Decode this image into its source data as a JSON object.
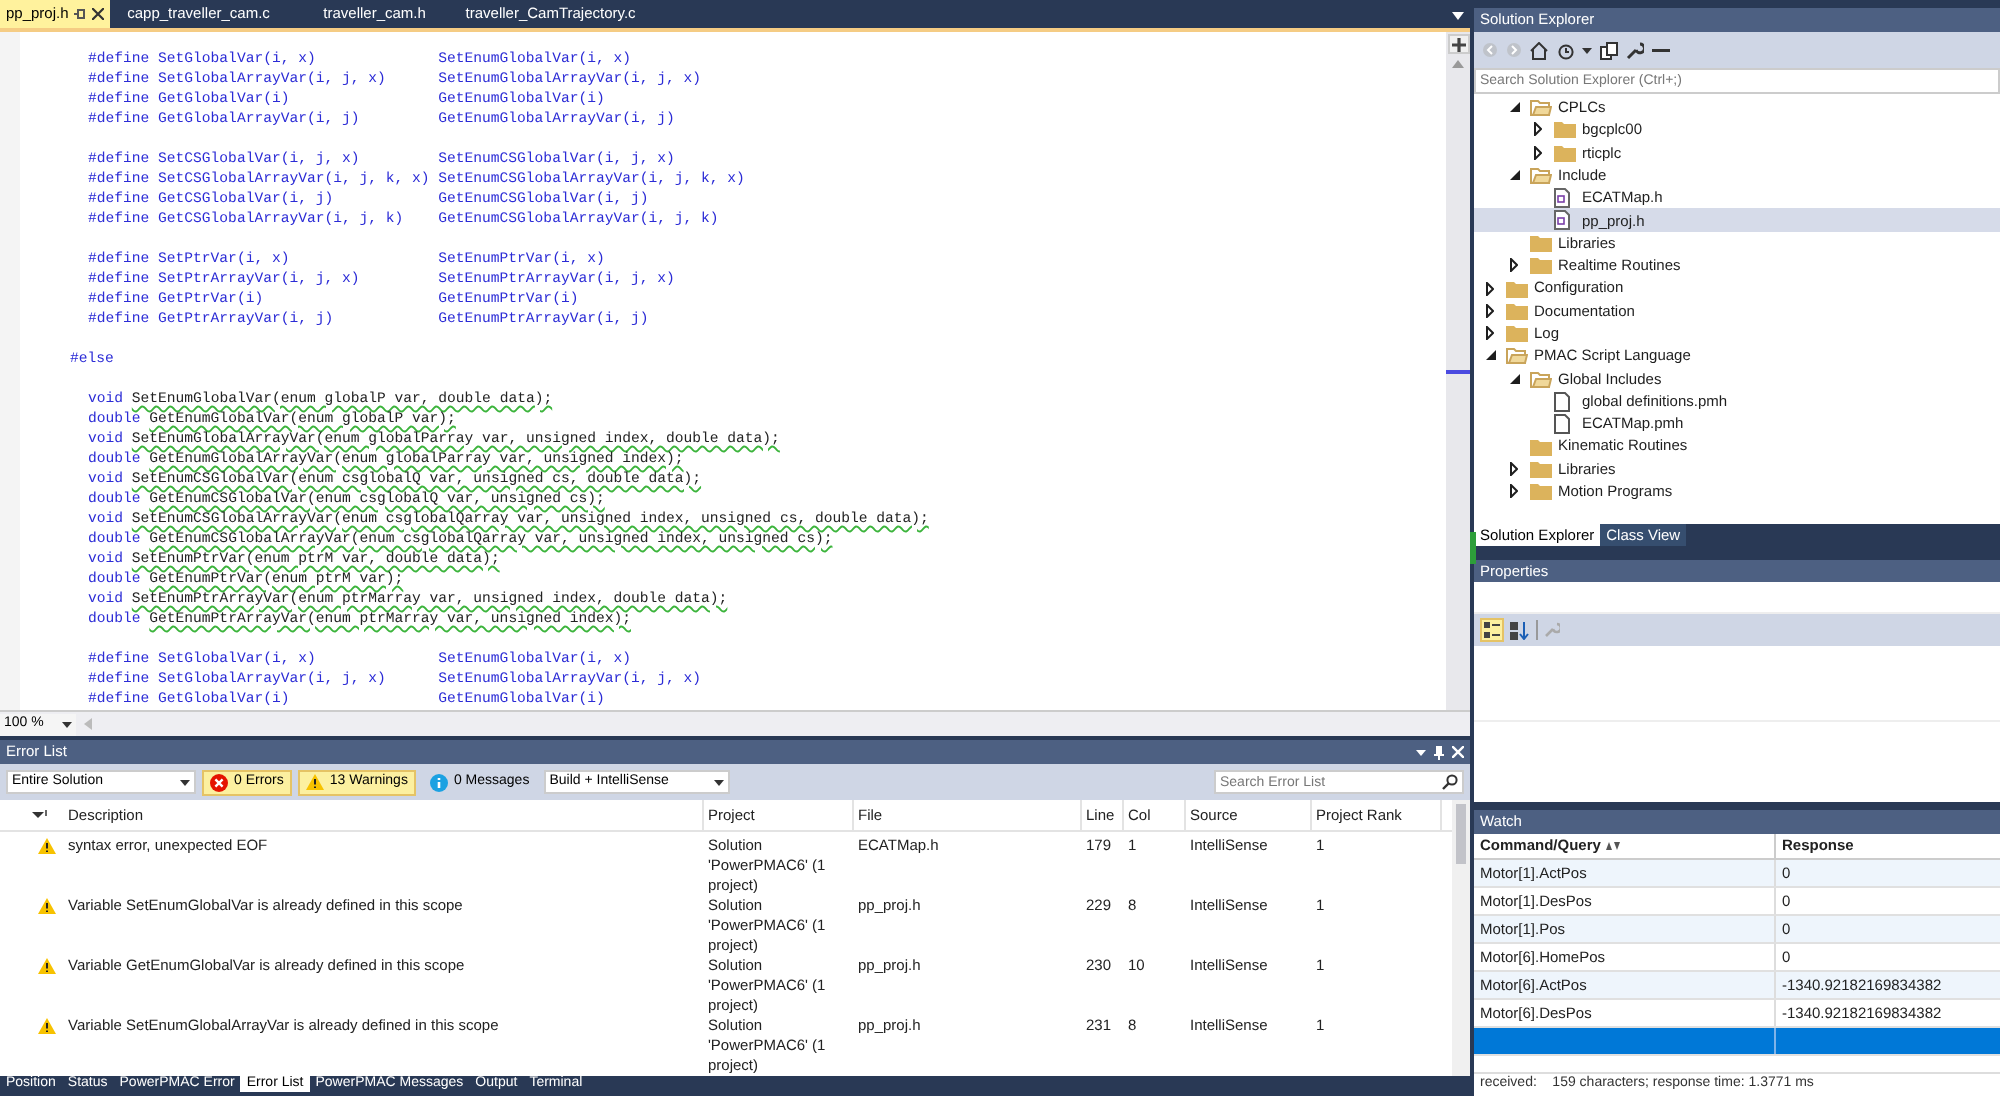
{
  "editor": {
    "tabs": [
      {
        "label": "pp_proj.h",
        "selected": true,
        "pinned": true
      },
      {
        "label": "capp_traveller_cam.c",
        "selected": false
      },
      {
        "label": "traveller_cam.h",
        "selected": false
      },
      {
        "label": "traveller_CamTrajectory.c",
        "selected": false
      }
    ],
    "lines": [
      {
        "kind": "define",
        "left": "#define SetGlobalVar(i, x)",
        "right": "SetEnumGlobalVar(i, x)"
      },
      {
        "kind": "define",
        "left": "#define SetGlobalArrayVar(i, j, x)",
        "right": "SetEnumGlobalArrayVar(i, j, x)"
      },
      {
        "kind": "define",
        "left": "#define GetGlobalVar(i)",
        "right": "GetEnumGlobalVar(i)"
      },
      {
        "kind": "define",
        "left": "#define GetGlobalArrayVar(i, j)",
        "right": "GetEnumGlobalArrayVar(i, j)"
      },
      {
        "kind": "blank"
      },
      {
        "kind": "define",
        "left": "#define SetCSGlobalVar(i, j, x)",
        "right": "SetEnumCSGlobalVar(i, j, x)"
      },
      {
        "kind": "define",
        "left": "#define SetCSGlobalArrayVar(i, j, k, x)",
        "right": "SetEnumCSGlobalArrayVar(i, j, k, x)"
      },
      {
        "kind": "define",
        "left": "#define GetCSGlobalVar(i, j)",
        "right": "GetEnumCSGlobalVar(i, j)"
      },
      {
        "kind": "define",
        "left": "#define GetCSGlobalArrayVar(i, j, k)",
        "right": "GetEnumCSGlobalArrayVar(i, j, k)"
      },
      {
        "kind": "blank"
      },
      {
        "kind": "define",
        "left": "#define SetPtrVar(i, x)",
        "right": "SetEnumPtrVar(i, x)"
      },
      {
        "kind": "define",
        "left": "#define SetPtrArrayVar(i, j, x)",
        "right": "SetEnumPtrArrayVar(i, j, x)"
      },
      {
        "kind": "define",
        "left": "#define GetPtrVar(i)",
        "right": "GetEnumPtrVar(i)"
      },
      {
        "kind": "define",
        "left": "#define GetPtrArrayVar(i, j)",
        "right": "GetEnumPtrArrayVar(i, j)"
      },
      {
        "kind": "blank"
      },
      {
        "kind": "directive",
        "text": "#else"
      },
      {
        "kind": "blank"
      },
      {
        "kind": "decl",
        "type": "void",
        "call": "SetEnumGlobalVar(enum globalP var, double data);",
        "squiggle": true
      },
      {
        "kind": "decl",
        "type": "double",
        "call": "GetEnumGlobalVar(enum globalP var);",
        "squiggle": true
      },
      {
        "kind": "decl",
        "type": "void",
        "call": "SetEnumGlobalArrayVar(enum globalParray var, unsigned index, double data);",
        "squiggle": true
      },
      {
        "kind": "decl",
        "type": "double",
        "call": "GetEnumGlobalArrayVar(enum globalParray var, unsigned index);",
        "squiggle": true
      },
      {
        "kind": "decl",
        "type": "void",
        "call": "SetEnumCSGlobalVar(enum csglobalQ var, unsigned cs, double data);",
        "squiggle": true
      },
      {
        "kind": "decl",
        "type": "double",
        "call": "GetEnumCSGlobalVar(enum csglobalQ var, unsigned cs);",
        "squiggle": true
      },
      {
        "kind": "decl",
        "type": "void",
        "call": "SetEnumCSGlobalArrayVar(enum csglobalQarray var, unsigned index, unsigned cs, double data);",
        "squiggle": true
      },
      {
        "kind": "decl",
        "type": "double",
        "call": "GetEnumCSGlobalArrayVar(enum csglobalQarray var, unsigned index, unsigned cs);",
        "squiggle": true
      },
      {
        "kind": "decl",
        "type": "void",
        "call": "SetEnumPtrVar(enum ptrM var, double data);",
        "squiggle": true
      },
      {
        "kind": "decl",
        "type": "double",
        "call": "GetEnumPtrVar(enum ptrM var);",
        "squiggle": true
      },
      {
        "kind": "decl",
        "type": "void",
        "call": "SetEnumPtrArrayVar(enum ptrMarray var, unsigned index, double data);",
        "squiggle": true
      },
      {
        "kind": "decl",
        "type": "double",
        "call": "GetEnumPtrArrayVar(enum ptrMarray var, unsigned index);",
        "squiggle": true
      },
      {
        "kind": "blank"
      },
      {
        "kind": "define",
        "left": "#define SetGlobalVar(i, x)",
        "right": "SetEnumGlobalVar(i, x)"
      },
      {
        "kind": "define",
        "left": "#define SetGlobalArrayVar(i, j, x)",
        "right": "SetEnumGlobalArrayVar(i, j, x)"
      },
      {
        "kind": "define",
        "left": "#define GetGlobalVar(i)",
        "right": "GetEnumGlobalVar(i)"
      }
    ],
    "zoom": "100 %"
  },
  "error_list": {
    "title": "Error List",
    "scope": "Entire Solution",
    "filters": [
      {
        "kind": "error",
        "label": "0 Errors",
        "selected": true
      },
      {
        "kind": "warning",
        "label": "13 Warnings",
        "selected": true
      },
      {
        "kind": "info",
        "label": "0 Messages",
        "selected": false
      }
    ],
    "source_filter": "Build + IntelliSense",
    "search": {
      "placeholder": "Search Error List"
    },
    "columns": [
      "Description",
      "Project",
      "File",
      "Line",
      "Col",
      "Source",
      "Project Rank"
    ],
    "rows": [
      {
        "kind": "warning",
        "description": "syntax error, unexpected EOF",
        "project": "Solution 'PowerPMAC6' (1 project)",
        "file": "ECATMap.h",
        "line": "179",
        "col": "1",
        "source": "IntelliSense",
        "rank": "1"
      },
      {
        "kind": "warning",
        "description": "Variable SetEnumGlobalVar is already defined in this scope",
        "project": "Solution 'PowerPMAC6' (1 project)",
        "file": "pp_proj.h",
        "line": "229",
        "col": "8",
        "source": "IntelliSense",
        "rank": "1"
      },
      {
        "kind": "warning",
        "description": "Variable GetEnumGlobalVar is already defined in this scope",
        "project": "Solution 'PowerPMAC6' (1 project)",
        "file": "pp_proj.h",
        "line": "230",
        "col": "10",
        "source": "IntelliSense",
        "rank": "1"
      },
      {
        "kind": "warning",
        "description": "Variable SetEnumGlobalArrayVar is already defined in this scope",
        "project": "Solution 'PowerPMAC6' (1 project)",
        "file": "pp_proj.h",
        "line": "231",
        "col": "8",
        "source": "IntelliSense",
        "rank": "1"
      }
    ]
  },
  "bottom_tabs": [
    {
      "label": "Position",
      "selected": false
    },
    {
      "label": "Status",
      "selected": false
    },
    {
      "label": "PowerPMAC Error",
      "selected": false
    },
    {
      "label": "Error List",
      "selected": true
    },
    {
      "label": "PowerPMAC Messages",
      "selected": false
    },
    {
      "label": "Output",
      "selected": false
    },
    {
      "label": "Terminal",
      "selected": false
    }
  ],
  "solution_explorer": {
    "title": "Solution Explorer",
    "search": {
      "placeholder": "Search Solution Explorer (Ctrl+;)"
    },
    "tree": {
      "partial_children": [
        {
          "label": "CPLCs",
          "kind": "folder",
          "expanded": true,
          "selected": false,
          "children": [
            {
              "label": "bgcplc00",
              "kind": "folder",
              "expanded": false,
              "selected": false
            },
            {
              "label": "rticplc",
              "kind": "folder",
              "expanded": false,
              "selected": false
            }
          ]
        },
        {
          "label": "Include",
          "kind": "folder",
          "expanded": true,
          "selected": false,
          "children": [
            {
              "label": "ECATMap.h",
              "kind": "header",
              "selected": false
            },
            {
              "label": "pp_proj.h",
              "kind": "header",
              "selected": true
            }
          ]
        },
        {
          "label": "Libraries",
          "kind": "folder",
          "selected": false
        },
        {
          "label": "Realtime Routines",
          "kind": "folder",
          "expanded": false,
          "selected": false
        }
      ],
      "items": [
        {
          "label": "Configuration",
          "kind": "folder",
          "expanded": false,
          "selected": false
        },
        {
          "label": "Documentation",
          "kind": "folder",
          "expanded": false,
          "selected": false
        },
        {
          "label": "Log",
          "kind": "folder",
          "expanded": false,
          "selected": false
        },
        {
          "label": "PMAC Script Language",
          "kind": "folder",
          "expanded": true,
          "selected": false,
          "children": [
            {
              "label": "Global Includes",
              "kind": "folder",
              "expanded": true,
              "selected": false,
              "children": [
                {
                  "label": "global definitions.pmh",
                  "kind": "script",
                  "selected": false
                },
                {
                  "label": "ECATMap.pmh",
                  "kind": "script",
                  "selected": false
                }
              ]
            },
            {
              "label": "Kinematic Routines",
              "kind": "folder",
              "selected": false
            },
            {
              "label": "Libraries",
              "kind": "folder",
              "expanded": false,
              "selected": false
            },
            {
              "label": "Motion Programs",
              "kind": "folder",
              "expanded": false,
              "selected": false
            }
          ]
        }
      ]
    },
    "tabs": [
      {
        "label": "Solution Explorer",
        "selected": true
      },
      {
        "label": "Class View",
        "selected": false
      }
    ]
  },
  "properties": {
    "title": "Properties"
  },
  "watch": {
    "title": "Watch",
    "columns": [
      "Command/Query",
      "Response"
    ],
    "rows": [
      {
        "command": "Motor[1].ActPos",
        "response": "0",
        "selected": false
      },
      {
        "command": "Motor[1].DesPos",
        "response": "0",
        "selected": false
      },
      {
        "command": "Motor[1].Pos",
        "response": "0",
        "selected": false
      },
      {
        "command": "Motor[6].HomePos",
        "response": "0",
        "selected": false
      },
      {
        "command": "Motor[6].ActPos",
        "response": "-1340.92182169834382",
        "selected": false
      },
      {
        "command": "Motor[6].DesPos",
        "response": "-1340.92182169834382",
        "selected": false
      },
      {
        "selected": true
      }
    ],
    "status": "received:    159 characters; response time: 1.3771 ms"
  }
}
